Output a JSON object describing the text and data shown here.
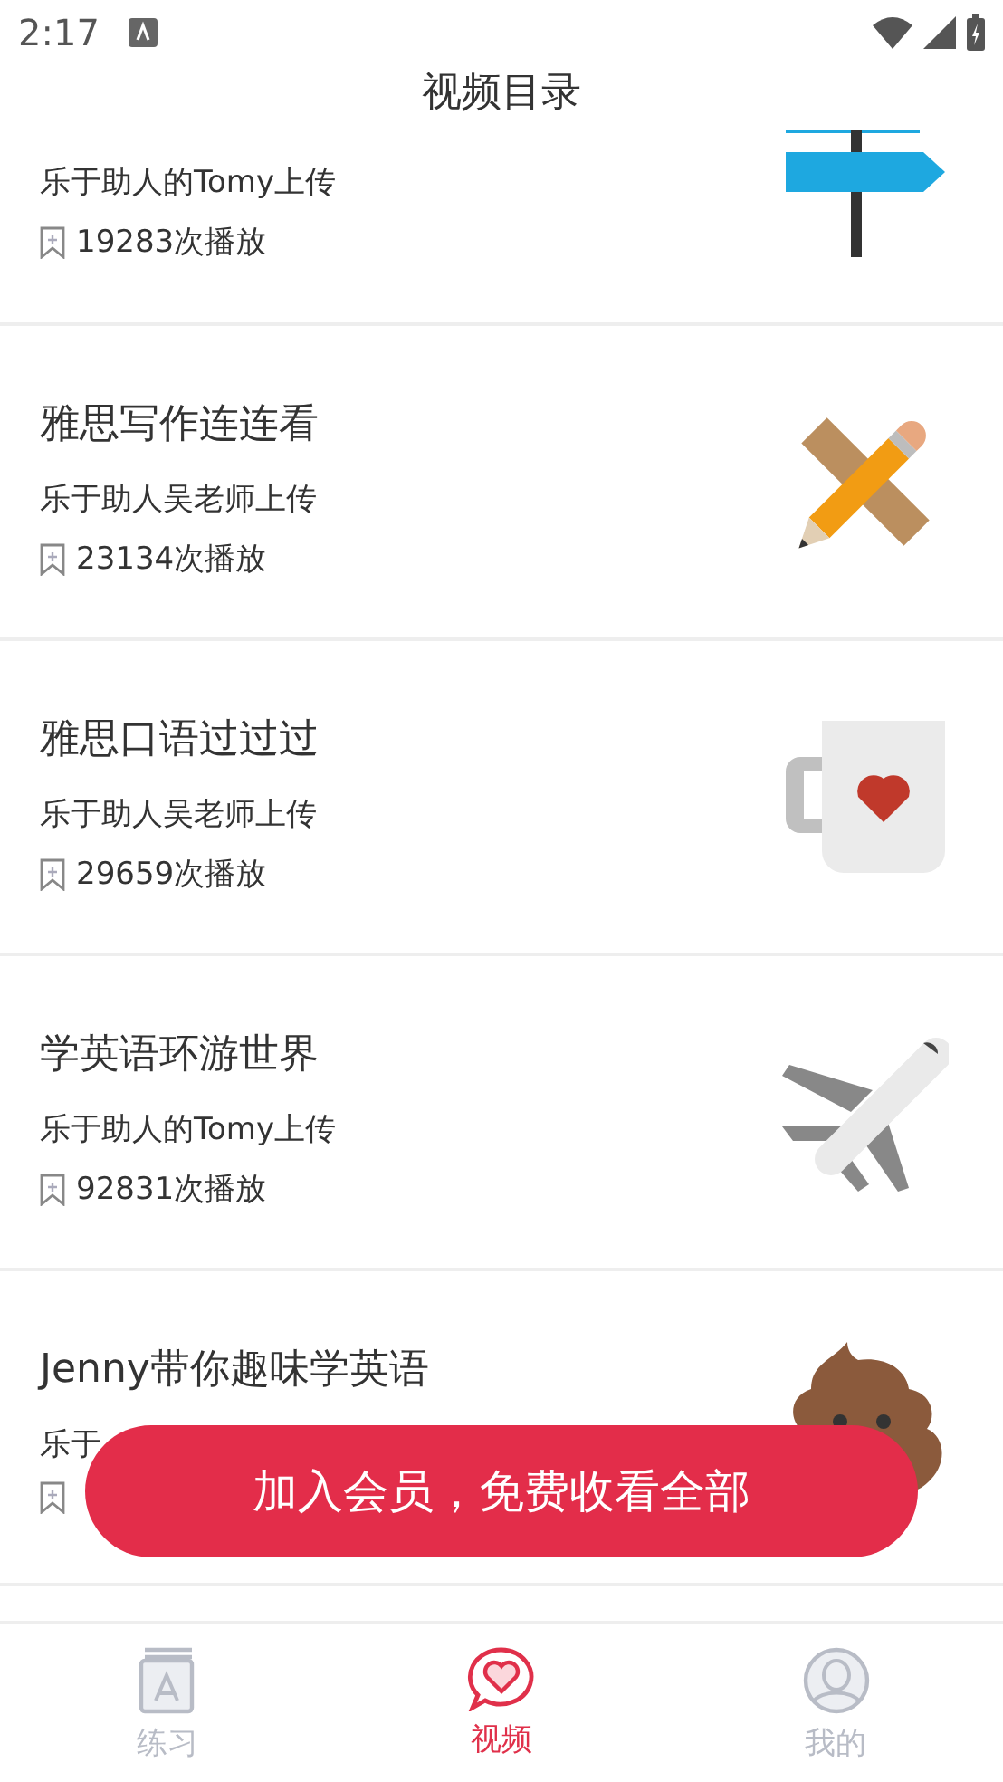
{
  "status_bar": {
    "time": "2:17"
  },
  "header": {
    "title": "视频目录"
  },
  "videos": [
    {
      "uploader": "乐于助人的Tomy上传",
      "plays": "19283次播放"
    },
    {
      "title": "雅思写作连连看",
      "uploader": "乐于助人吴老师上传",
      "plays": "23134次播放"
    },
    {
      "title": "雅思口语过过过",
      "uploader": "乐于助人吴老师上传",
      "plays": "29659次播放"
    },
    {
      "title": "学英语环游世界",
      "uploader": "乐于助人的Tomy上传",
      "plays": "92831次播放"
    },
    {
      "title": "Jenny带你趣味学英语",
      "uploader": "乐于"
    }
  ],
  "cta_button": {
    "label": "加入会员，免费收看全部"
  },
  "tabs": [
    {
      "label": "练习",
      "selected": false
    },
    {
      "label": "视频",
      "selected": true
    },
    {
      "label": "我的",
      "selected": false
    }
  ]
}
